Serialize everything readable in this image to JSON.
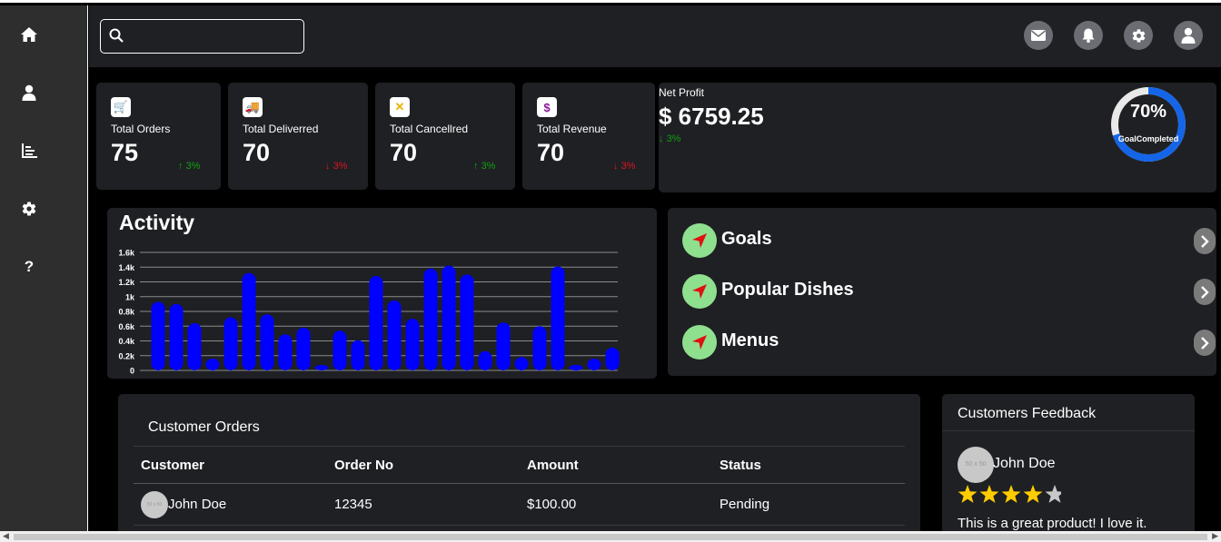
{
  "sidebar": {
    "items": [
      {
        "icon": "home-icon"
      },
      {
        "icon": "user-icon"
      },
      {
        "icon": "chart-icon"
      },
      {
        "icon": "gear-icon"
      },
      {
        "icon": "help-icon",
        "glyph": "?"
      }
    ]
  },
  "header": {
    "search": {
      "placeholder": "",
      "value": ""
    },
    "buttons": [
      "mail-icon",
      "bell-icon",
      "gear-icon",
      "user-icon"
    ]
  },
  "stats": [
    {
      "label": "Total Orders",
      "value": "75",
      "trend": "3%",
      "direction": "up",
      "icon_glyph": "🛒",
      "icon_color": "#10a010"
    },
    {
      "label": "Total Deliverred",
      "value": "70",
      "trend": "3%",
      "direction": "down",
      "icon_glyph": "🚚",
      "icon_color": "#2035c8"
    },
    {
      "label": "Total Cancellred",
      "value": "70",
      "trend": "3%",
      "direction": "up",
      "icon_glyph": "✕",
      "icon_color": "#e8b400"
    },
    {
      "label": "Total Revenue",
      "value": "70",
      "trend": "3%",
      "direction": "down",
      "icon_glyph": "$",
      "icon_color": "#8a1a9a"
    }
  ],
  "net_profit": {
    "label": "Net Profit",
    "value": "$ 6759.25",
    "trend": "3%",
    "goal_percent": "70%",
    "goal_fraction": 0.7,
    "goal_label": "GoalCompleted"
  },
  "activity": {
    "title": "Activity"
  },
  "chart_data": {
    "type": "bar",
    "title": "Activity",
    "ylim": [
      0,
      1600
    ],
    "yticks": [
      "0",
      "0.2k",
      "0.4k",
      "0.6k",
      "0.8k",
      "1k",
      "1.2k",
      "1.4k",
      "1.6k"
    ],
    "values": [
      930,
      900,
      640,
      160,
      720,
      1320,
      760,
      490,
      580,
      70,
      540,
      410,
      1280,
      950,
      700,
      1380,
      1420,
      1300,
      260,
      650,
      180,
      600,
      1410,
      70,
      160,
      310
    ],
    "bar_color": "#0000ff",
    "grid": true
  },
  "nav_list": [
    {
      "label": "Goals"
    },
    {
      "label": "Popular Dishes"
    },
    {
      "label": "Menus"
    }
  ],
  "orders": {
    "title": "Customer Orders",
    "columns": [
      "Customer",
      "Order No",
      "Amount",
      "Status"
    ],
    "rows": [
      {
        "customer": "John Doe",
        "order_no": "12345",
        "amount": "$100.00",
        "status": "Pending",
        "avatar_text": "50 x 50"
      }
    ]
  },
  "feedback": {
    "title": "Customers Feedback",
    "name": "John Doe",
    "avatar_text": "50 x 50",
    "rating": 4,
    "rating_max": 5,
    "comment": "This is a great product! I love it."
  }
}
